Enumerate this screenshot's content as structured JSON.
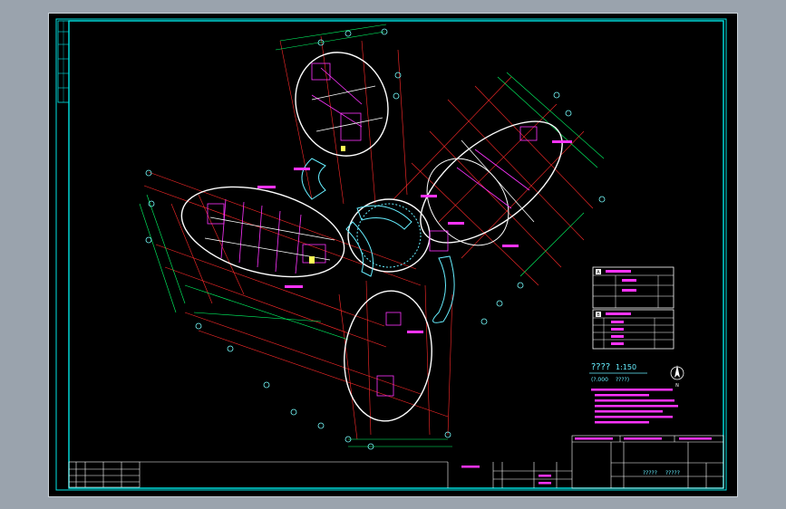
{
  "colors": {
    "background": "#000000",
    "frame": "#00e5e5",
    "walls": "#ffffff",
    "grid": "#ff2a2a",
    "dims": "#00ff66",
    "labels": "#ff33ff",
    "text_cyan": "#66eeff"
  },
  "drawing": {
    "title": "????",
    "scale": "1:150",
    "elevation": "(?.000",
    "elevation_note": "????)"
  },
  "legend": {
    "schedule_a_badge": "A",
    "schedule_b_badge": "B",
    "north_arrow_letter": "N"
  },
  "title_block": {
    "drawing_name_1": "?????",
    "drawing_name_2": "?????"
  }
}
